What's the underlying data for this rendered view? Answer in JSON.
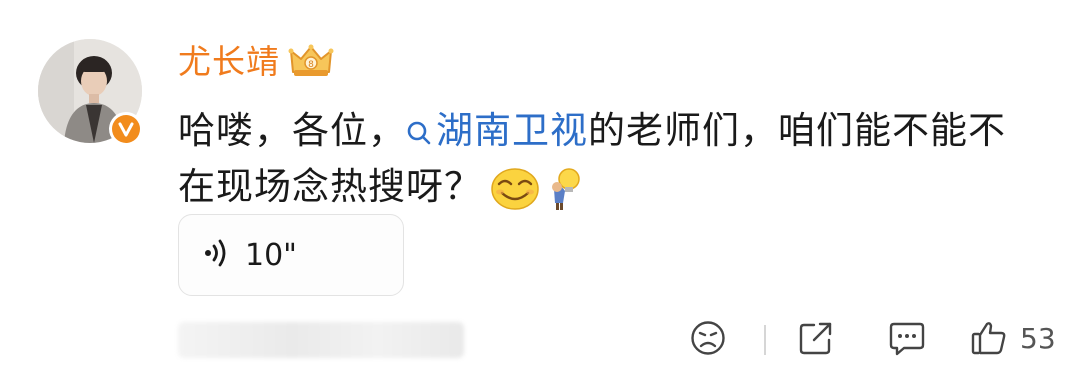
{
  "post": {
    "username": "尤长靖",
    "text_before": "哈喽，各位，",
    "topic": "湖南卫视",
    "text_after": "的老师们，咱们能不能不在现场念热搜呀？"
  },
  "voice": {
    "duration": "10\""
  },
  "actions": {
    "like_count": "53"
  },
  "colors": {
    "username": "#f07b1d",
    "topic_link": "#2d6ec8",
    "verified_badge": "#f28c1c"
  },
  "icons": {
    "crown": "crown-icon",
    "verified": "verified-badge-icon",
    "topic": "search-icon",
    "voice": "voice-wave-icon",
    "dislike": "sad-face-icon",
    "share": "share-icon",
    "comment": "comment-icon",
    "like": "thumbs-up-icon"
  }
}
